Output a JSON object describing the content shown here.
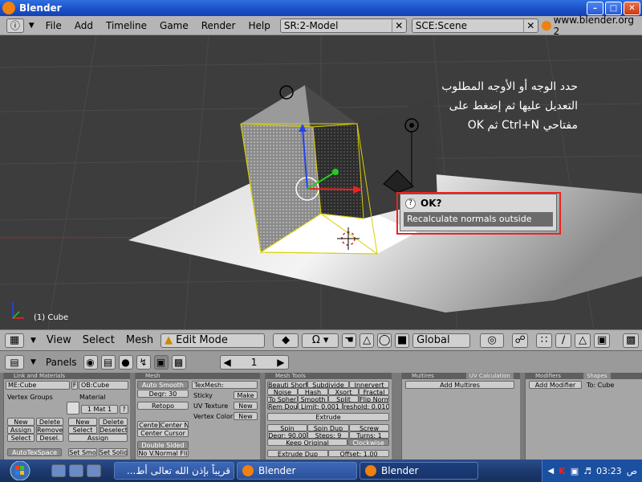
{
  "window": {
    "title": "Blender"
  },
  "menubar": {
    "items": [
      "File",
      "Add",
      "Timeline",
      "Game",
      "Render",
      "Help"
    ],
    "screen_field": "SR:2-Model",
    "scene_field": "SCE:Scene",
    "website": "www.blender.org 2"
  },
  "viewport": {
    "instruction_lines": [
      "حدد الوجه أو الأوجه المطلوب",
      "التعديل عليها ثم إضغط على",
      "مفتاحي Ctrl+N ثم OK"
    ],
    "object_label": "(1) Cube",
    "popup": {
      "title": "OK?",
      "option": "Recalculate normals outside"
    }
  },
  "view_header": {
    "menus": [
      "View",
      "Select",
      "Mesh"
    ],
    "mode": "Edit Mode",
    "orientation": "Global"
  },
  "buttons_header": {
    "label": "Panels",
    "frame": "1"
  },
  "panels": {
    "link_materials": {
      "header": "Link and Materials",
      "me_field": "ME:Cube",
      "f_label": "F",
      "ob_field": "OB:Cube",
      "vertex_groups": "Vertex Groups",
      "material_label": "Material",
      "mat_field": "1 Mat 1",
      "question": "?",
      "vg_buttons": [
        "New",
        "Delete",
        "Assign",
        "Remove",
        "Select",
        "Desel."
      ],
      "mat_buttons": [
        "New",
        "Delete",
        "Select",
        "Deselect"
      ],
      "assign": "Assign",
      "bottom": [
        "AutoTexSpace",
        "Set Smo",
        "Set Solid"
      ]
    },
    "mesh": {
      "header": "Mesh",
      "auto_smooth": "Auto Smooth",
      "degr": "Degr: 30",
      "retopo": "Retopo",
      "texmesh": "TexMesh:",
      "sticky": "Sticky",
      "make": "Make",
      "uv_texture": "UV Texture",
      "vertex_color": "Vertex Color",
      "new1": "New",
      "new2": "New",
      "center": "Cente",
      "center_new": "Center Ne",
      "center_cursor": "Center Cursor",
      "double_sided": "Double Sided",
      "no_vnormal": "No V.Normal Fli"
    },
    "mesh_tools": {
      "header": "Mesh Tools",
      "row1": [
        "Beauti Short",
        "Subdivide",
        "Innervert"
      ],
      "row2": [
        "Noise",
        "Hash",
        "Xsort",
        "Fractal"
      ],
      "row3": [
        "To Spher",
        "Smooth",
        "Split",
        "Flip Norm"
      ],
      "row4": [
        "Rem Dou",
        "Limit: 0.001",
        "reshold: 0.010"
      ],
      "extrude": "Extrude",
      "row5": [
        "Spin",
        "Spin Dup",
        "Screw"
      ],
      "row6": [
        "Degr: 90.00",
        "Steps: 9",
        "Turns: 1"
      ],
      "keep_original": "Keep Original",
      "clockwise": "Clockwise",
      "extrude_dup": "Extrude Dup",
      "offset": "Offset: 1.00"
    },
    "multires": {
      "header": "Multires",
      "tab2": "UV Calculation",
      "add": "Add Multires"
    },
    "modifiers": {
      "header": "Modifiers",
      "tab2": "Shapes",
      "add": "Add Modifier",
      "to": "To: Cube"
    }
  },
  "taskbar": {
    "tasks": [
      "قريباً بإذن الله تعالى أط...",
      "Blender",
      "Blender"
    ],
    "clock": "03:23",
    "ampm": "ص"
  },
  "colors": {
    "selection_outline": "#e22222",
    "xp_blue": "#245edb",
    "blender_grey": "#b5b5b5"
  }
}
